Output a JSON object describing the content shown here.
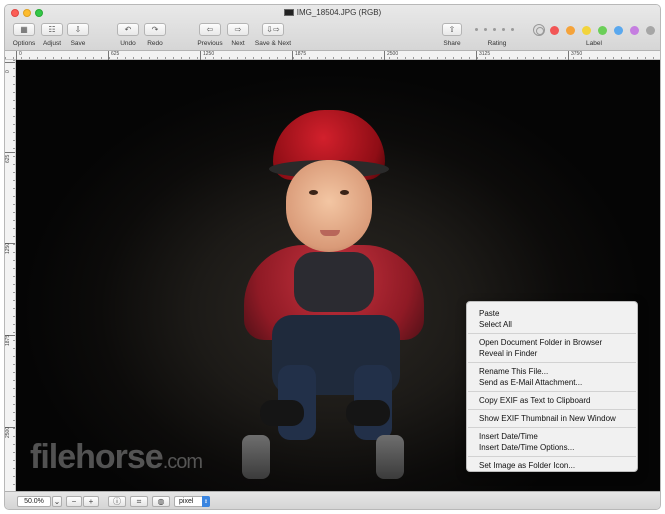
{
  "window": {
    "title": "IMG_18504.JPG (RGB)"
  },
  "toolbar": {
    "options": {
      "label": "Options",
      "icon": "options-icon",
      "glyph": "▦"
    },
    "adjust": {
      "label": "Adjust",
      "icon": "adjust-icon",
      "glyph": "☷"
    },
    "save": {
      "label": "Save",
      "icon": "save-icon",
      "glyph": "⇩"
    },
    "undo": {
      "label": "Undo",
      "icon": "undo-icon",
      "glyph": "↶"
    },
    "redo": {
      "label": "Redo",
      "icon": "redo-icon",
      "glyph": "↷"
    },
    "previous": {
      "label": "Previous",
      "icon": "arrow-left-icon",
      "glyph": "⇦"
    },
    "next": {
      "label": "Next",
      "icon": "arrow-right-icon",
      "glyph": "⇨"
    },
    "save_next": {
      "label": "Save & Next",
      "icon": "save-next-icon",
      "glyph": "⇩⇨"
    },
    "share": {
      "label": "Share",
      "icon": "share-icon",
      "glyph": "⇧"
    },
    "rating_label": "Rating",
    "label_label": "Label",
    "label_colors": [
      "#f25656",
      "#f5a33a",
      "#f2d43c",
      "#6bcf58",
      "#5aa8ee",
      "#c57ee0",
      "#a6a6a6"
    ]
  },
  "rulers": {
    "horizontal": [
      "0",
      "625",
      "1250",
      "1875",
      "2500",
      "3125",
      "3750"
    ],
    "vertical": [
      "0",
      "625",
      "1250",
      "1875",
      "2500"
    ]
  },
  "watermark": {
    "text": "filehorse",
    "suffix": ".com"
  },
  "context_menu": {
    "items": [
      "Paste",
      "Select All",
      "Open Document Folder in Browser",
      "Reveal in Finder",
      "Rename This File...",
      "Send as E-Mail Attachment...",
      "Copy EXIF as Text to Clipboard",
      "Show EXIF Thumbnail in New Window",
      "Insert Date/Time",
      "Insert Date/Time Options...",
      "Set Image as Folder Icon..."
    ]
  },
  "statusbar": {
    "zoom": "50.0%",
    "zoom_dropdown_glyph": "⌄",
    "zoom_out_glyph": "−",
    "zoom_in_glyph": "+",
    "info_glyph": "ⓘ",
    "info_icon": "info-icon",
    "crop_glyph": "⌗",
    "crop_icon": "crop-icon",
    "globe_glyph": "◍",
    "globe_icon": "globe-icon",
    "unit": "pixel",
    "unit_arrow_glyph": "⇕"
  }
}
